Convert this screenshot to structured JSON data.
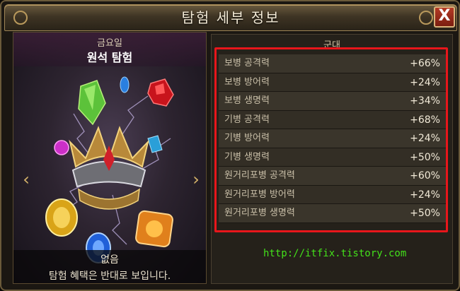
{
  "window": {
    "title": "탐험 세부 정보",
    "close_label": "X"
  },
  "left_panel": {
    "day": "금요일",
    "mode": "원석 탐험",
    "prev_label": "‹",
    "next_label": "›",
    "reward": "없음",
    "note": "탐험 혜택은 반대로 보입니다."
  },
  "right_panel": {
    "header": "군대",
    "stats": [
      {
        "label": "보병 공격력",
        "value": "+66%"
      },
      {
        "label": "보병 방어력",
        "value": "+24%"
      },
      {
        "label": "보병 생명력",
        "value": "+34%"
      },
      {
        "label": "기병 공격력",
        "value": "+68%"
      },
      {
        "label": "기병 방어력",
        "value": "+24%"
      },
      {
        "label": "기병 생명력",
        "value": "+50%"
      },
      {
        "label": "원거리포병 공격력",
        "value": "+60%"
      },
      {
        "label": "원거리포병 방어력",
        "value": "+24%"
      },
      {
        "label": "원거리포병 생명력",
        "value": "+50%"
      }
    ]
  },
  "watermark": "http://itfix.tistory.com",
  "colors": {
    "highlight_box": "#e8161b",
    "watermark": "#43e01a",
    "accent_gold": "#d6b46a"
  }
}
